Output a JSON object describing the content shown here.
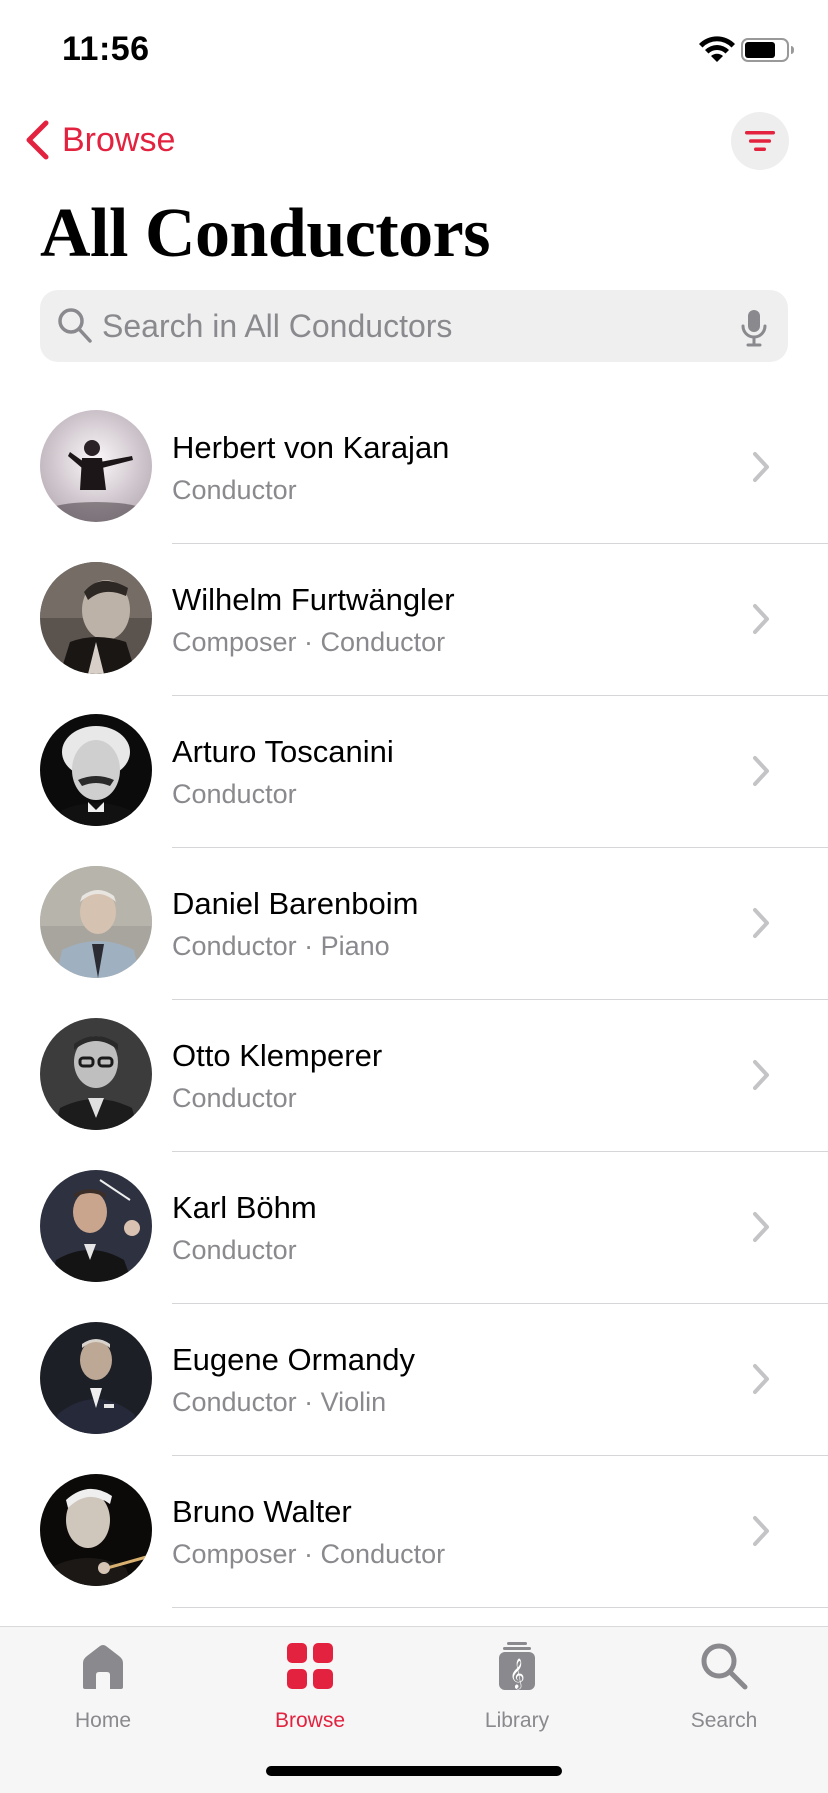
{
  "status_bar": {
    "time": "11:56",
    "battery_level": 0.75
  },
  "nav": {
    "back_label": "Browse"
  },
  "page": {
    "title": "All Conductors"
  },
  "search": {
    "placeholder": "Search in All Conductors"
  },
  "conductors": [
    {
      "name": "Herbert von Karajan",
      "subtitle": "Conductor"
    },
    {
      "name": "Wilhelm Furtwängler",
      "subtitle": "Composer · Conductor"
    },
    {
      "name": "Arturo Toscanini",
      "subtitle": "Conductor"
    },
    {
      "name": "Daniel Barenboim",
      "subtitle": "Conductor · Piano"
    },
    {
      "name": "Otto Klemperer",
      "subtitle": "Conductor"
    },
    {
      "name": "Karl Böhm",
      "subtitle": "Conductor"
    },
    {
      "name": "Eugene Ormandy",
      "subtitle": "Conductor · Violin"
    },
    {
      "name": "Bruno Walter",
      "subtitle": "Composer · Conductor"
    }
  ],
  "tabs": [
    {
      "label": "Home",
      "icon": "house-icon",
      "active": false
    },
    {
      "label": "Browse",
      "icon": "grid-icon",
      "active": true
    },
    {
      "label": "Library",
      "icon": "library-icon",
      "active": false
    },
    {
      "label": "Search",
      "icon": "search-icon",
      "active": false
    }
  ],
  "colors": {
    "accent": "#e3223f",
    "secondary_text": "#8a8a8e",
    "search_bg": "#efeff0"
  }
}
